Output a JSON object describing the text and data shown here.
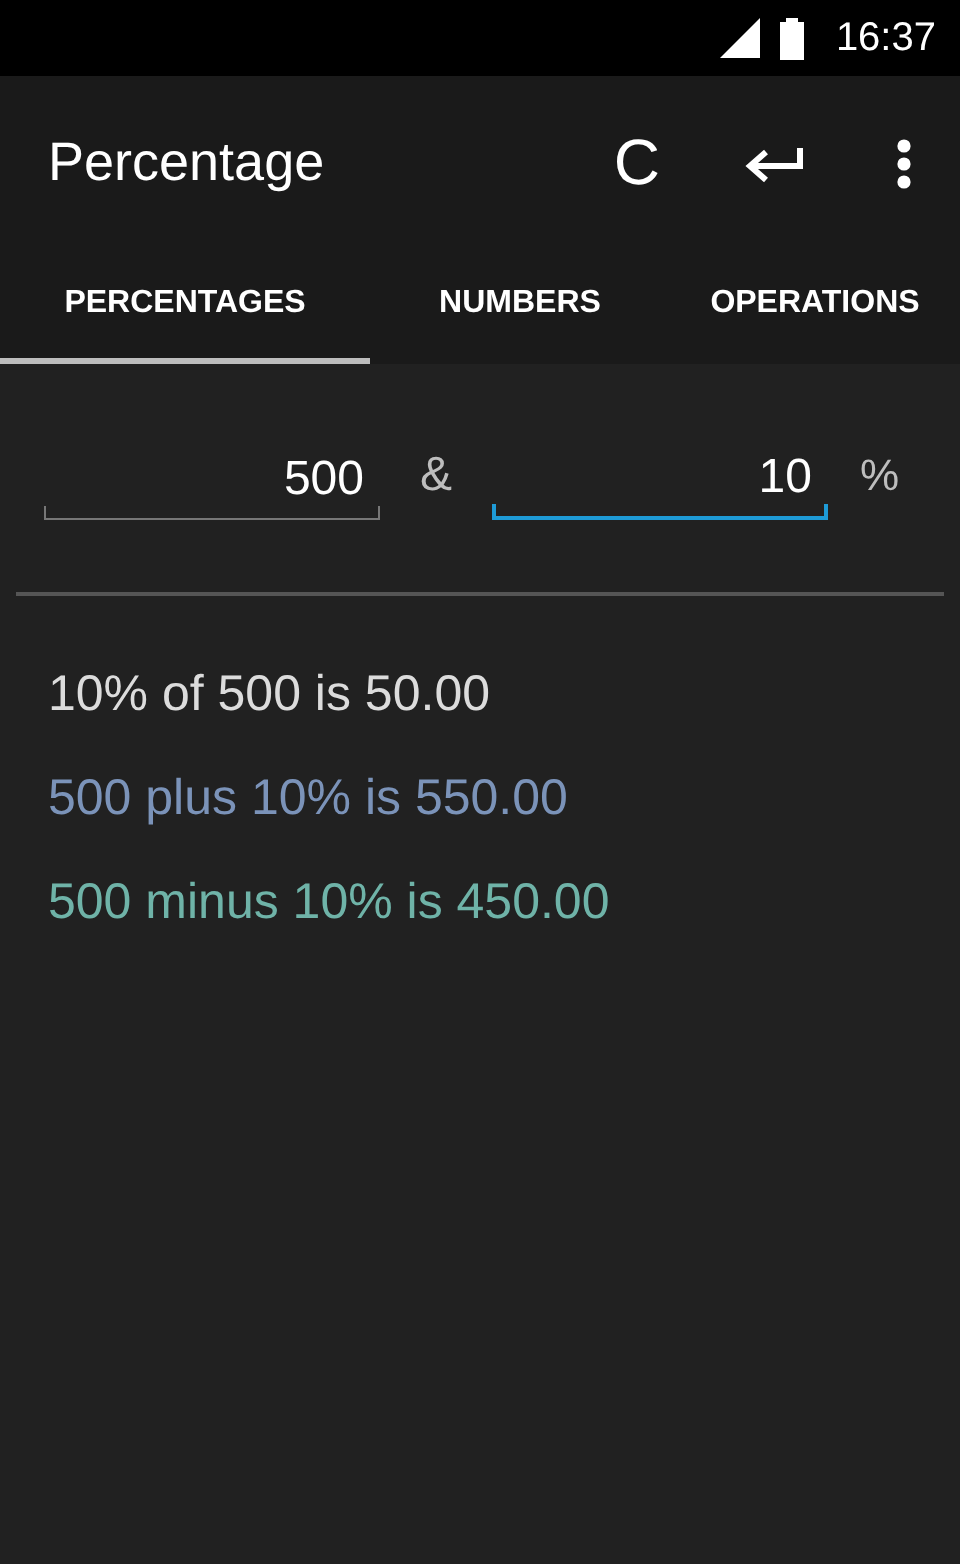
{
  "status_bar": {
    "time": "16:37"
  },
  "toolbar": {
    "title": "Percentage",
    "clear_label": "C"
  },
  "tabs": [
    {
      "label": "PERCENTAGES",
      "selected": true
    },
    {
      "label": "NUMBERS",
      "selected": false
    },
    {
      "label": "OPERATIONS",
      "selected": false
    }
  ],
  "inputs": [
    {
      "value": "500",
      "focused": false
    },
    {
      "value": "10",
      "focused": true
    }
  ],
  "separator": "&",
  "percent_sign": "%",
  "results": [
    {
      "text": "10% of 500 is 50.00",
      "color": "#dcdcdc"
    },
    {
      "text": "500 plus 10% is 550.00",
      "color": "#7b93b9"
    },
    {
      "text": "500 minus 10% is 450.00",
      "color": "#6fb3a8"
    }
  ]
}
